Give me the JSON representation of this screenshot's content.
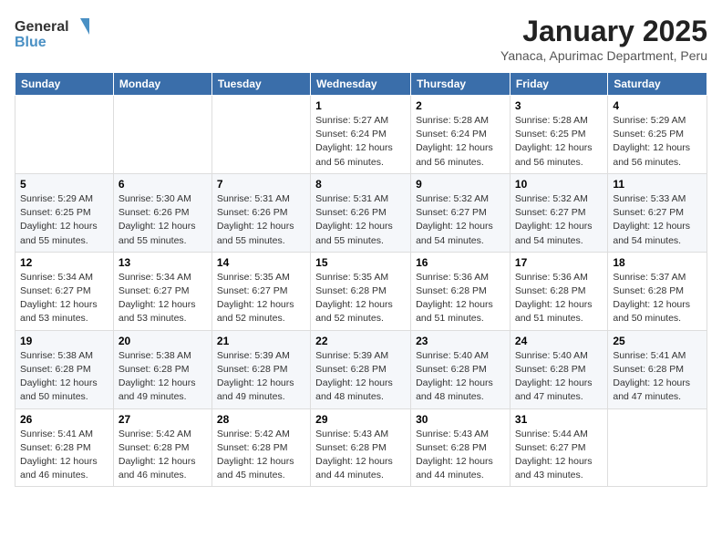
{
  "header": {
    "logo_line1": "General",
    "logo_line2": "Blue",
    "title": "January 2025",
    "subtitle": "Yanaca, Apurimac Department, Peru"
  },
  "weekdays": [
    "Sunday",
    "Monday",
    "Tuesday",
    "Wednesday",
    "Thursday",
    "Friday",
    "Saturday"
  ],
  "weeks": [
    [
      {
        "day": "",
        "info": ""
      },
      {
        "day": "",
        "info": ""
      },
      {
        "day": "",
        "info": ""
      },
      {
        "day": "1",
        "info": "Sunrise: 5:27 AM\nSunset: 6:24 PM\nDaylight: 12 hours\nand 56 minutes."
      },
      {
        "day": "2",
        "info": "Sunrise: 5:28 AM\nSunset: 6:24 PM\nDaylight: 12 hours\nand 56 minutes."
      },
      {
        "day": "3",
        "info": "Sunrise: 5:28 AM\nSunset: 6:25 PM\nDaylight: 12 hours\nand 56 minutes."
      },
      {
        "day": "4",
        "info": "Sunrise: 5:29 AM\nSunset: 6:25 PM\nDaylight: 12 hours\nand 56 minutes."
      }
    ],
    [
      {
        "day": "5",
        "info": "Sunrise: 5:29 AM\nSunset: 6:25 PM\nDaylight: 12 hours\nand 55 minutes."
      },
      {
        "day": "6",
        "info": "Sunrise: 5:30 AM\nSunset: 6:26 PM\nDaylight: 12 hours\nand 55 minutes."
      },
      {
        "day": "7",
        "info": "Sunrise: 5:31 AM\nSunset: 6:26 PM\nDaylight: 12 hours\nand 55 minutes."
      },
      {
        "day": "8",
        "info": "Sunrise: 5:31 AM\nSunset: 6:26 PM\nDaylight: 12 hours\nand 55 minutes."
      },
      {
        "day": "9",
        "info": "Sunrise: 5:32 AM\nSunset: 6:27 PM\nDaylight: 12 hours\nand 54 minutes."
      },
      {
        "day": "10",
        "info": "Sunrise: 5:32 AM\nSunset: 6:27 PM\nDaylight: 12 hours\nand 54 minutes."
      },
      {
        "day": "11",
        "info": "Sunrise: 5:33 AM\nSunset: 6:27 PM\nDaylight: 12 hours\nand 54 minutes."
      }
    ],
    [
      {
        "day": "12",
        "info": "Sunrise: 5:34 AM\nSunset: 6:27 PM\nDaylight: 12 hours\nand 53 minutes."
      },
      {
        "day": "13",
        "info": "Sunrise: 5:34 AM\nSunset: 6:27 PM\nDaylight: 12 hours\nand 53 minutes."
      },
      {
        "day": "14",
        "info": "Sunrise: 5:35 AM\nSunset: 6:27 PM\nDaylight: 12 hours\nand 52 minutes."
      },
      {
        "day": "15",
        "info": "Sunrise: 5:35 AM\nSunset: 6:28 PM\nDaylight: 12 hours\nand 52 minutes."
      },
      {
        "day": "16",
        "info": "Sunrise: 5:36 AM\nSunset: 6:28 PM\nDaylight: 12 hours\nand 51 minutes."
      },
      {
        "day": "17",
        "info": "Sunrise: 5:36 AM\nSunset: 6:28 PM\nDaylight: 12 hours\nand 51 minutes."
      },
      {
        "day": "18",
        "info": "Sunrise: 5:37 AM\nSunset: 6:28 PM\nDaylight: 12 hours\nand 50 minutes."
      }
    ],
    [
      {
        "day": "19",
        "info": "Sunrise: 5:38 AM\nSunset: 6:28 PM\nDaylight: 12 hours\nand 50 minutes."
      },
      {
        "day": "20",
        "info": "Sunrise: 5:38 AM\nSunset: 6:28 PM\nDaylight: 12 hours\nand 49 minutes."
      },
      {
        "day": "21",
        "info": "Sunrise: 5:39 AM\nSunset: 6:28 PM\nDaylight: 12 hours\nand 49 minutes."
      },
      {
        "day": "22",
        "info": "Sunrise: 5:39 AM\nSunset: 6:28 PM\nDaylight: 12 hours\nand 48 minutes."
      },
      {
        "day": "23",
        "info": "Sunrise: 5:40 AM\nSunset: 6:28 PM\nDaylight: 12 hours\nand 48 minutes."
      },
      {
        "day": "24",
        "info": "Sunrise: 5:40 AM\nSunset: 6:28 PM\nDaylight: 12 hours\nand 47 minutes."
      },
      {
        "day": "25",
        "info": "Sunrise: 5:41 AM\nSunset: 6:28 PM\nDaylight: 12 hours\nand 47 minutes."
      }
    ],
    [
      {
        "day": "26",
        "info": "Sunrise: 5:41 AM\nSunset: 6:28 PM\nDaylight: 12 hours\nand 46 minutes."
      },
      {
        "day": "27",
        "info": "Sunrise: 5:42 AM\nSunset: 6:28 PM\nDaylight: 12 hours\nand 46 minutes."
      },
      {
        "day": "28",
        "info": "Sunrise: 5:42 AM\nSunset: 6:28 PM\nDaylight: 12 hours\nand 45 minutes."
      },
      {
        "day": "29",
        "info": "Sunrise: 5:43 AM\nSunset: 6:28 PM\nDaylight: 12 hours\nand 44 minutes."
      },
      {
        "day": "30",
        "info": "Sunrise: 5:43 AM\nSunset: 6:28 PM\nDaylight: 12 hours\nand 44 minutes."
      },
      {
        "day": "31",
        "info": "Sunrise: 5:44 AM\nSunset: 6:27 PM\nDaylight: 12 hours\nand 43 minutes."
      },
      {
        "day": "",
        "info": ""
      }
    ]
  ]
}
